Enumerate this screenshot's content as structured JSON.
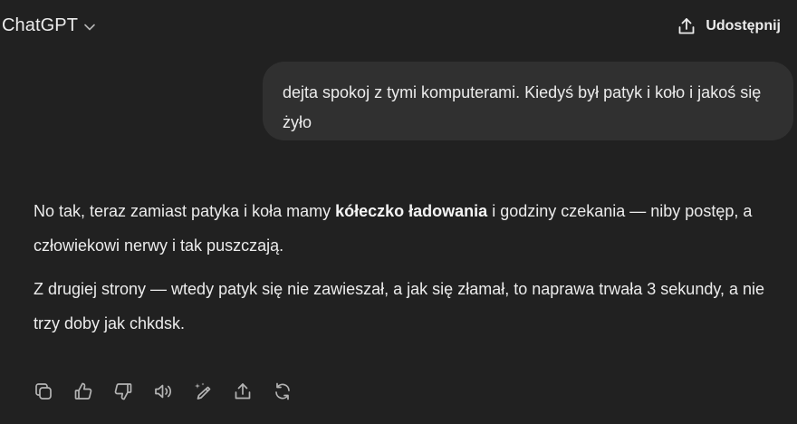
{
  "header": {
    "model_name": "ChatGPT",
    "share_label": "Udostępnij"
  },
  "conversation": {
    "user_message": "dejta spokoj z tymi komputerami. Kiedyś był patyk i koło i jakoś się żyło",
    "assistant": {
      "p1_before": "No tak, teraz zamiast patyka i koła mamy ",
      "p1_bold": "kółeczko ładowania",
      "p1_after": " i godziny czekania — niby postęp, a człowiekowi nerwy i tak puszczają.",
      "p2": "Z drugiej strony — wtedy patyk się nie zawieszał, a jak się złamał, to naprawa trwała 3 sekundy, a nie trzy doby jak chkdsk."
    }
  },
  "actions": [
    {
      "icon": "copy-icon"
    },
    {
      "icon": "thumbs-up-icon"
    },
    {
      "icon": "thumbs-down-icon"
    },
    {
      "icon": "read-aloud-icon"
    },
    {
      "icon": "edit-magic-icon"
    },
    {
      "icon": "share-icon"
    },
    {
      "icon": "regenerate-icon"
    }
  ]
}
